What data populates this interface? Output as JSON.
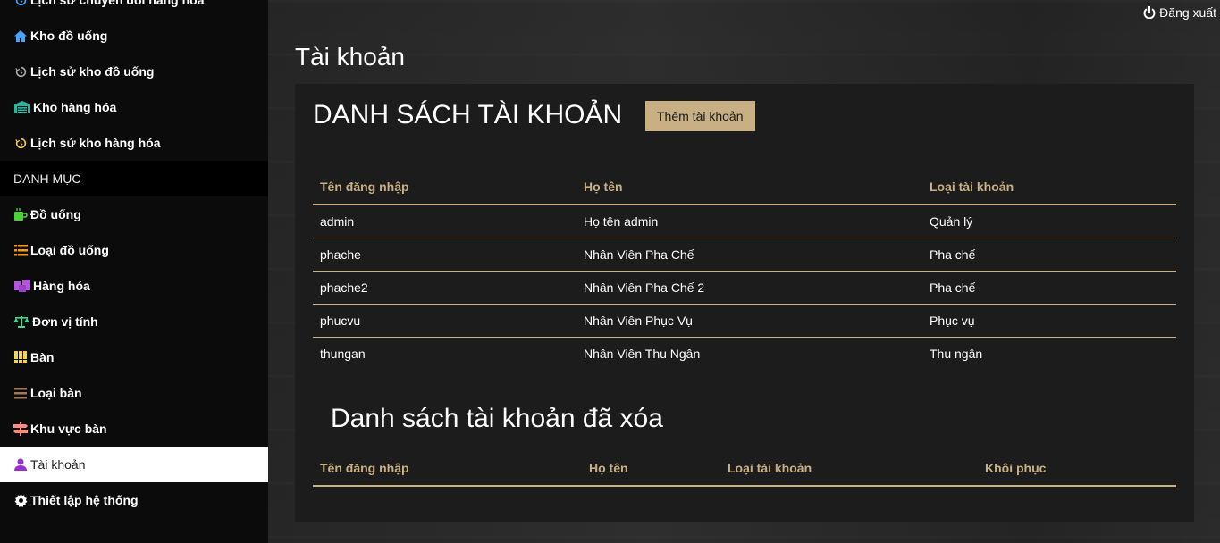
{
  "sidebar": {
    "items": [
      {
        "label": "Lịch sử chuyển đổi hàng hóa",
        "icon": "history-icon",
        "color": "#4aa3ff"
      },
      {
        "label": "Kho đồ uống",
        "icon": "home-icon",
        "color": "#4aa3ff"
      },
      {
        "label": "Lịch sử kho đồ uống",
        "icon": "history-icon",
        "color": "#aaaaaa"
      },
      {
        "label": "Kho hàng hóa",
        "icon": "warehouse-icon",
        "color": "#2bb5a0"
      },
      {
        "label": "Lịch sử kho hàng hóa",
        "icon": "history-icon",
        "color": "#f2c94c"
      }
    ],
    "section_header": "DANH MỤC",
    "catalog": [
      {
        "label": "Đồ uống",
        "icon": "coffee-icon",
        "color": "#4cd137"
      },
      {
        "label": "Loại đồ uống",
        "icon": "list-icon",
        "color": "#f39c12"
      },
      {
        "label": "Hàng hóa",
        "icon": "boxes-icon",
        "color": "#b455e0"
      },
      {
        "label": "Đơn vị tính",
        "icon": "scale-icon",
        "color": "#3ddc97"
      },
      {
        "label": "Bàn",
        "icon": "grid-icon",
        "color": "#f1d44a"
      },
      {
        "label": "Loại bàn",
        "icon": "bars-icon",
        "color": "#a0785a"
      },
      {
        "label": "Khu vực bàn",
        "icon": "signpost-icon",
        "color": "#ff8a80"
      },
      {
        "label": "Tài khoản",
        "icon": "user-icon",
        "color": "#9b2fc9",
        "active": true
      },
      {
        "label": "Thiết lập hệ thống",
        "icon": "gear-icon",
        "color": "#ffffff"
      }
    ]
  },
  "header": {
    "logout_label": "Đăng xuất"
  },
  "main": {
    "page_title": "Tài khoản",
    "list_heading": "DANH SÁCH TÀI KHOẢN",
    "add_button": "Thêm tài khoản",
    "columns": [
      "Tên đăng nhập",
      "Họ tên",
      "Loại tài khoản"
    ],
    "rows": [
      [
        "admin",
        "Họ tên admin",
        "Quản lý"
      ],
      [
        "phache",
        "Nhân Viên Pha Chế",
        "Pha chế"
      ],
      [
        "phache2",
        "Nhân Viên Pha Chế 2",
        "Pha chế"
      ],
      [
        "phucvu",
        "Nhân Viên Phục Vụ",
        "Phục vụ"
      ],
      [
        "thungan",
        "Nhân Viên Thu Ngân",
        "Thu ngân"
      ]
    ],
    "deleted_heading": "Danh sách tài khoản đã xóa",
    "deleted_columns": [
      "Tên đăng nhập",
      "Họ tên",
      "Loại tài khoản",
      "Khôi phục"
    ]
  },
  "colors": {
    "accent": "#c8b084",
    "sidebar_bg": "#0b0b0b",
    "panel_bg": "#1c1c1c"
  }
}
